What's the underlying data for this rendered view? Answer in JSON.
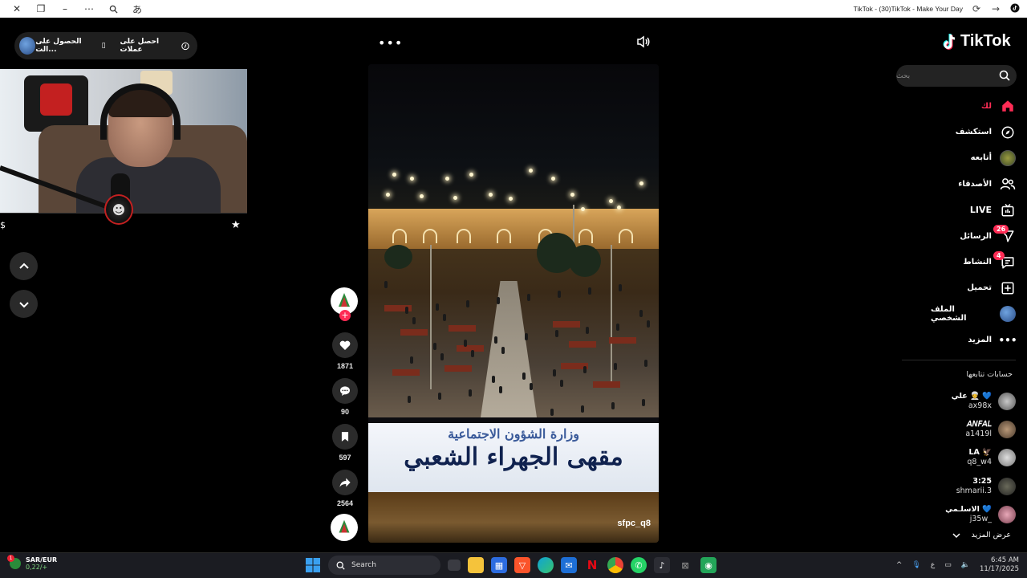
{
  "window": {
    "title": "TikTok - (30)TikTok - Make Your Day"
  },
  "get_pill": {
    "coins_label": "احصل على عملات",
    "get_label": "الحصول على الت..."
  },
  "webcam": {
    "dollar": "$"
  },
  "video": {
    "username": "sfpc_q8",
    "sign_top": "وزارة الشؤون الاجتماعية",
    "sign_main": "مقهى الجهراء الشعبي"
  },
  "actions": {
    "likes": "1871",
    "comments": "90",
    "saves": "597",
    "shares": "2564"
  },
  "sidebar": {
    "logo": "TikTok",
    "search_placeholder": "بحث",
    "menu": [
      {
        "label": "لك",
        "icon": "home-icon",
        "active": true
      },
      {
        "label": "استكشف",
        "icon": "compass-icon"
      },
      {
        "label": "أتابعه",
        "icon": "following-avatar"
      },
      {
        "label": "الأصدقاء",
        "icon": "friends-icon"
      },
      {
        "label": "LIVE",
        "icon": "live-icon"
      },
      {
        "label": "الرسائل",
        "icon": "messages-icon",
        "badge": "26"
      },
      {
        "label": "النشاط",
        "icon": "activity-icon",
        "badge": "4"
      },
      {
        "label": "تحميل",
        "icon": "upload-icon"
      },
      {
        "label": "الملف الشخصي",
        "icon": "profile-avatar"
      },
      {
        "label": "المزيد",
        "icon": "more-icon"
      }
    ],
    "following_title": "حسابات تتابعها",
    "following": [
      {
        "name": "علي 👳 💙",
        "handle": "ax98x"
      },
      {
        "name": "𝘈𝘕𝘍𝘈𝘓",
        "handle": "a1419l"
      },
      {
        "name": "LA 🦅",
        "handle": "q8_w4"
      },
      {
        "name": "3:25",
        "handle": "shmarii.3"
      },
      {
        "name": "الاسلـمي 💙",
        "handle": "j35w_"
      }
    ],
    "see_more": "عرض المزيد"
  },
  "taskbar": {
    "currency": "SAR/EUR",
    "currency_change": "0,22/+",
    "search_label": "Search",
    "lang": "ع",
    "time": "6:45 AM",
    "date": "11/17/2025"
  },
  "colors": {
    "accent": "#fe2c55",
    "background": "#000000"
  }
}
